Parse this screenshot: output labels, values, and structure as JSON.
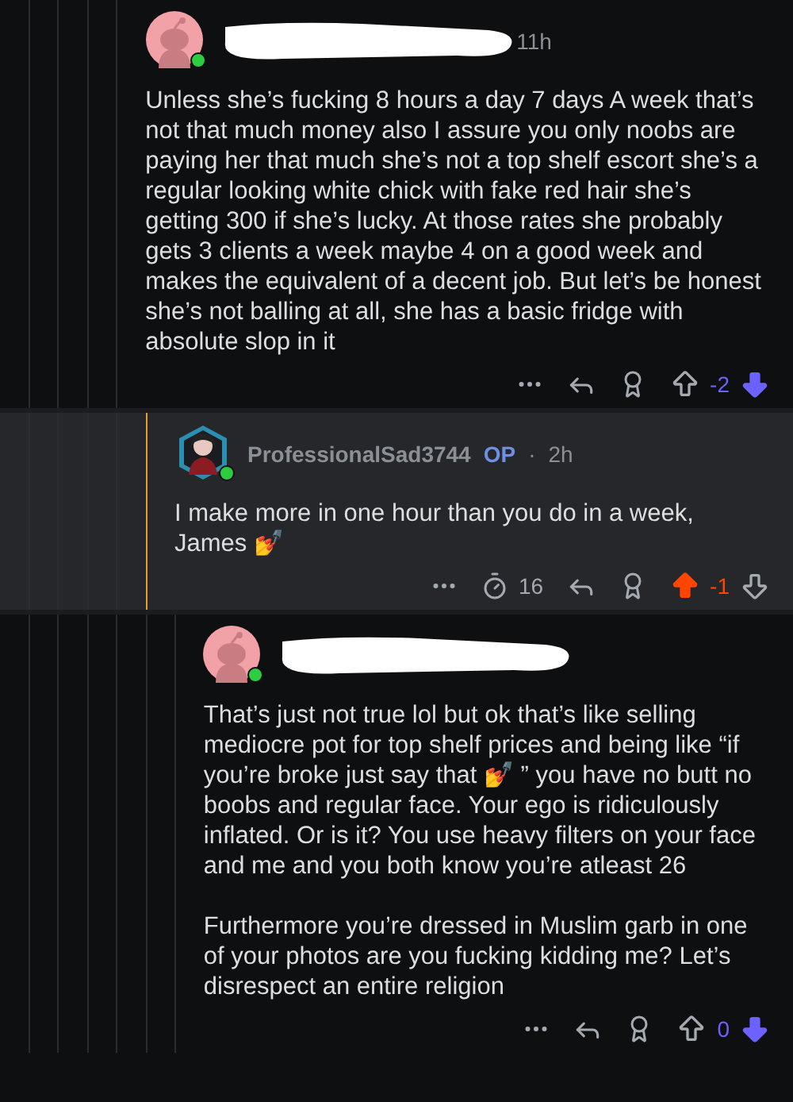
{
  "comments": [
    {
      "avatar": {
        "kind": "snoo"
      },
      "online": true,
      "author_redacted": true,
      "time": "11h",
      "highlighted": false,
      "body": [
        "Unless she’s fucking 8 hours a day 7 days A week that’s not that much money also I assure you only noobs are paying her that much she’s not a top shelf escort she’s a regular looking white chick with fake red hair she’s getting 300 if she’s lucky. At those rates she probably gets 3 clients a week maybe 4 on a good week and makes the equivalent of a decent job. But let’s be honest she’s not balling at all, she has a basic fridge with absolute slop in it"
      ],
      "upvoted": false,
      "downvoted": true,
      "score": "-2",
      "children": [
        {
          "avatar": {
            "kind": "character"
          },
          "online": true,
          "author": "ProfessionalSad3744",
          "op_badge": "OP",
          "separator": "·",
          "time": "2h",
          "highlighted": true,
          "body": [
            "I make more in one hour than you do in a week, James 💅"
          ],
          "timer_count": "16",
          "upvoted": true,
          "downvoted": false,
          "score": "-1",
          "children": [
            {
              "avatar": {
                "kind": "snoo"
              },
              "online": true,
              "author_redacted": true,
              "highlighted": false,
              "body": [
                "That’s just not true lol but ok  that’s like selling mediocre pot for top shelf prices and being like “if you’re broke just say that 💅 ” you have no butt no boobs and regular face. Your ego is ridiculously inflated. Or is it? You use heavy filters on your face and me and you both know you’re atleast 26",
                "Furthermore you’re dressed in Muslim garb in one of your photos are you fucking kidding me? Let’s disrespect an entire religion"
              ],
              "upvoted": false,
              "downvoted": true,
              "score": "0"
            }
          ]
        }
      ]
    }
  ]
}
